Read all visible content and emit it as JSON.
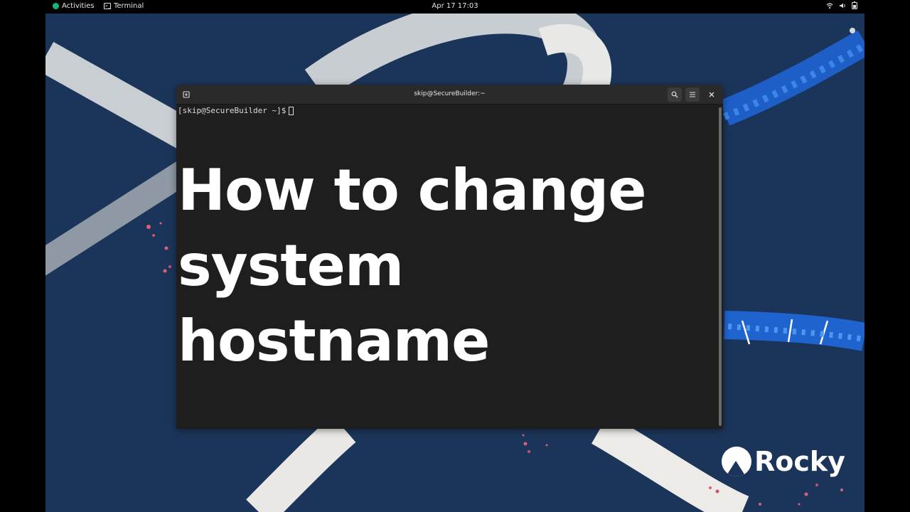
{
  "topbar": {
    "activities_label": "Activities",
    "app_label": "Terminal",
    "clock": "Apr 17  17:03",
    "tray_icons": [
      "wifi-icon",
      "volume-icon",
      "battery-icon"
    ]
  },
  "window": {
    "title": "skip@SecureBuilder:~",
    "prompt": "[skip@SecureBuilder ~]$"
  },
  "overlay": {
    "line1": "How to change",
    "line2": "system",
    "line3": "hostname"
  },
  "brand": {
    "logo_text": "Rocky",
    "accent": "#10b981"
  },
  "colors": {
    "desktop_bg": "#1b355a",
    "terminal_bg": "#1e1e1e"
  }
}
